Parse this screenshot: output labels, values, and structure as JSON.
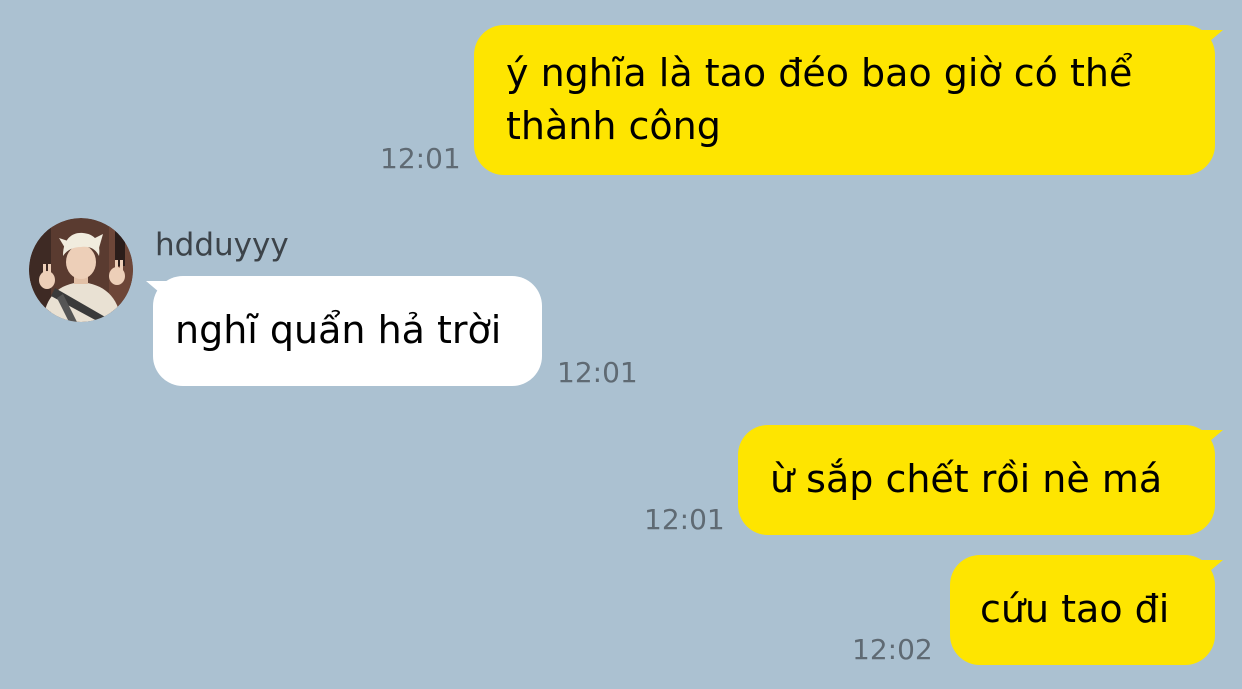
{
  "conversation": {
    "contact": {
      "name": "hdduyyy",
      "avatar_icon": "contact-avatar-photo"
    },
    "messages": [
      {
        "direction": "sent",
        "lines": [
          "ý nghĩa là tao đéo bao giờ có thể",
          "thành công"
        ],
        "time": "12:01"
      },
      {
        "direction": "received",
        "lines": [
          "nghĩ quẩn hả trời"
        ],
        "time": "12:01"
      },
      {
        "direction": "sent",
        "lines": [
          "ừ sắp chết rồi nè má"
        ],
        "time": "12:01"
      },
      {
        "direction": "sent",
        "lines": [
          "cứu tao đi"
        ],
        "time": "12:02"
      }
    ]
  },
  "colors": {
    "background": "#abc1d1",
    "sent_bubble": "#fee500",
    "received_bubble": "#ffffff",
    "timestamp": "#5f6a73"
  }
}
